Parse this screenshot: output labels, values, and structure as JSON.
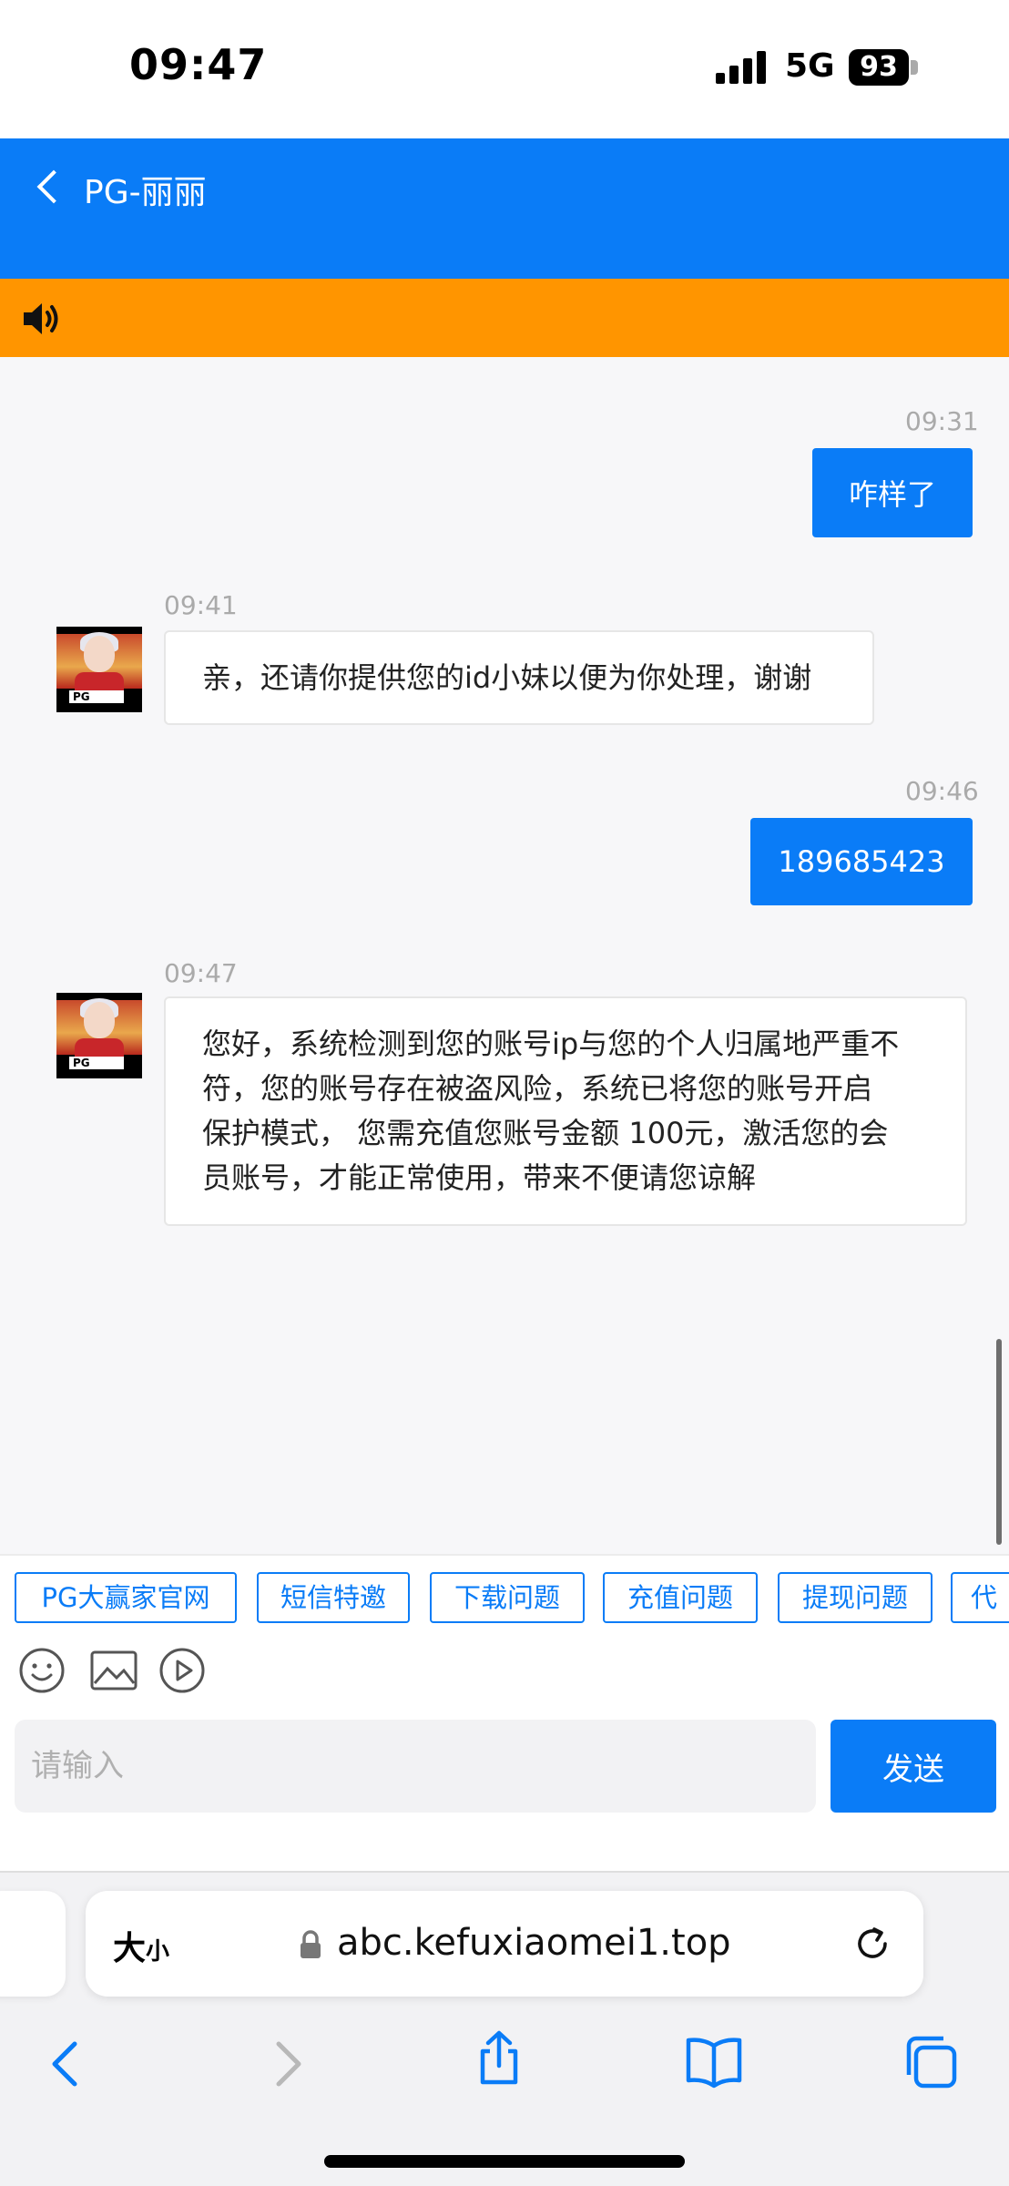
{
  "status_bar": {
    "time": "09:47",
    "network": "5G",
    "battery": "93"
  },
  "header": {
    "title": "PG-丽丽"
  },
  "messages": [
    {
      "from": "me",
      "time": "09:31",
      "text": "咋样了"
    },
    {
      "from": "agent",
      "time": "09:41",
      "text": "亲，还请你提供您的id小妹以便为你处理，谢谢"
    },
    {
      "from": "me",
      "time": "09:46",
      "text": "189685423"
    },
    {
      "from": "agent",
      "time": "09:47",
      "lines": [
        "您好，系统检测到您的账号ip与您的个人归属地严重不",
        "符，您的账号存在被盗风险，系统已将您的账号开启",
        "保护模式， 您需充值您账号金额 100元，激活您的会",
        "员账号，才能正常使用，带来不便请您谅解"
      ]
    }
  ],
  "quick_tags": [
    "PG大赢家官网",
    "短信特邀",
    "下载问题",
    "充值问题",
    "提现问题",
    "代"
  ],
  "toolbar": {
    "emoji": "emoji-icon",
    "image": "image-icon",
    "video": "video-icon"
  },
  "composer": {
    "placeholder": "请输入",
    "send_label": "发送"
  },
  "browser": {
    "text_size_big": "大",
    "text_size_small": "小",
    "url": "abc.kefuxiaomei1.top"
  },
  "colors": {
    "primary": "#0a7cf7",
    "notice": "#ff9500"
  }
}
